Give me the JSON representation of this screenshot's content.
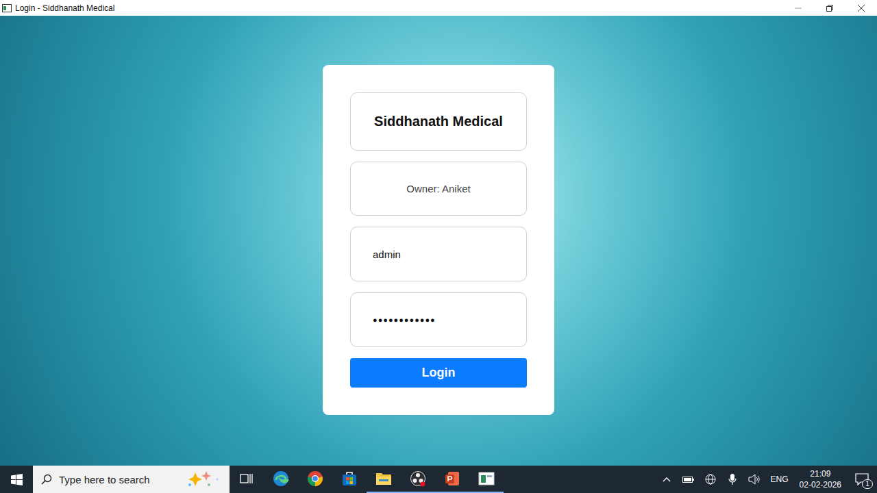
{
  "window": {
    "title": "Login - Siddhanath Medical"
  },
  "login": {
    "title": "Siddhanath Medical",
    "owner": "Owner: Aniket",
    "username": "admin",
    "password_mask": "●●●●●●●●●●●●",
    "button": "Login"
  },
  "taskbar": {
    "search": {
      "placeholder": "Type here to search"
    },
    "apps": [
      {
        "kind": "taskview",
        "running": false
      },
      {
        "kind": "edge",
        "running": false
      },
      {
        "kind": "chrome",
        "running": false
      },
      {
        "kind": "store",
        "running": false
      },
      {
        "kind": "explorer",
        "running": true
      },
      {
        "kind": "obs",
        "running": true
      },
      {
        "kind": "powerpoint",
        "running": true
      },
      {
        "kind": "app",
        "running": true
      }
    ],
    "tray": {
      "language": "ENG",
      "time": "21:09",
      "date": "02-02-2026",
      "notifications": "1"
    }
  }
}
